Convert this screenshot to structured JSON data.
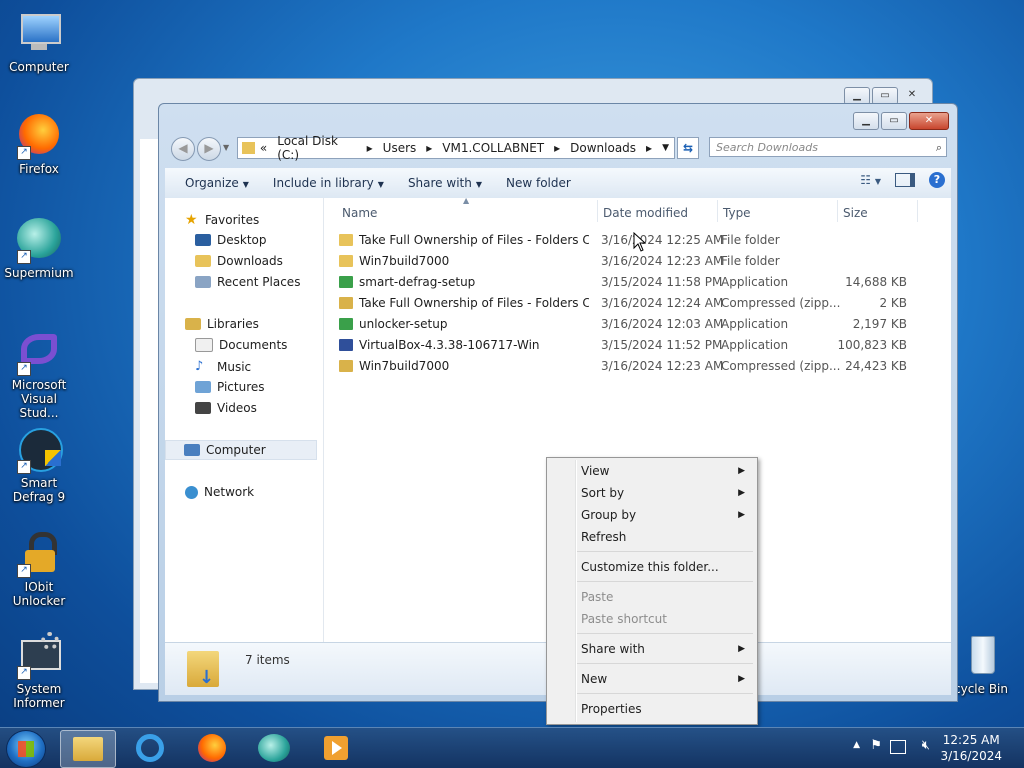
{
  "desktop": {
    "icons": [
      {
        "label": "Computer"
      },
      {
        "label": "Firefox"
      },
      {
        "label": "Supermium"
      },
      {
        "label": "Microsoft Visual Stud..."
      },
      {
        "label": "Smart Defrag 9"
      },
      {
        "label": "IObit Unlocker"
      },
      {
        "label": "System Informer"
      },
      {
        "label": "cycle Bin"
      }
    ]
  },
  "explorer": {
    "address": {
      "chevron": "«",
      "parts": [
        "Local Disk (C:)",
        "Users",
        "VM1.COLLABNET",
        "Downloads"
      ]
    },
    "search_placeholder": "Search Downloads",
    "toolbar": {
      "organize": "Organize",
      "include": "Include in library",
      "share": "Share with",
      "new_folder": "New folder"
    },
    "nav": {
      "favorites": "Favorites",
      "desktop": "Desktop",
      "downloads": "Downloads",
      "recent": "Recent Places",
      "libraries": "Libraries",
      "documents": "Documents",
      "music": "Music",
      "pictures": "Pictures",
      "videos": "Videos",
      "computer": "Computer",
      "network": "Network"
    },
    "columns": {
      "name": "Name",
      "date": "Date modified",
      "type": "Type",
      "size": "Size"
    },
    "files": [
      {
        "name": "Take Full Ownership of Files - Folders Co...",
        "date": "3/16/2024 12:25 AM",
        "type": "File folder",
        "size": "",
        "kind": "folder"
      },
      {
        "name": "Win7build7000",
        "date": "3/16/2024 12:23 AM",
        "type": "File folder",
        "size": "",
        "kind": "folder"
      },
      {
        "name": "smart-defrag-setup",
        "date": "3/15/2024 11:58 PM",
        "type": "Application",
        "size": "14,688 KB",
        "kind": "app-green"
      },
      {
        "name": "Take Full Ownership of Files - Folders Co...",
        "date": "3/16/2024 12:24 AM",
        "type": "Compressed (zipp...",
        "size": "2 KB",
        "kind": "zip"
      },
      {
        "name": "unlocker-setup",
        "date": "3/16/2024 12:03 AM",
        "type": "Application",
        "size": "2,197 KB",
        "kind": "app-green"
      },
      {
        "name": "VirtualBox-4.3.38-106717-Win",
        "date": "3/15/2024 11:52 PM",
        "type": "Application",
        "size": "100,823 KB",
        "kind": "app-vbox"
      },
      {
        "name": "Win7build7000",
        "date": "3/16/2024 12:23 AM",
        "type": "Compressed (zipp...",
        "size": "24,423 KB",
        "kind": "zip"
      }
    ],
    "status": "7 items"
  },
  "context_menu": {
    "view": "View",
    "sort_by": "Sort by",
    "group_by": "Group by",
    "refresh": "Refresh",
    "customize": "Customize this folder...",
    "paste": "Paste",
    "paste_shortcut": "Paste shortcut",
    "share_with": "Share with",
    "new": "New",
    "properties": "Properties"
  },
  "taskbar": {
    "time": "12:25 AM",
    "date": "3/16/2024"
  },
  "colors": {
    "folder": "#e8c35a",
    "zip": "#d9b24a",
    "app_green": "#3aa04a",
    "vbox": "#2f4f9a"
  }
}
